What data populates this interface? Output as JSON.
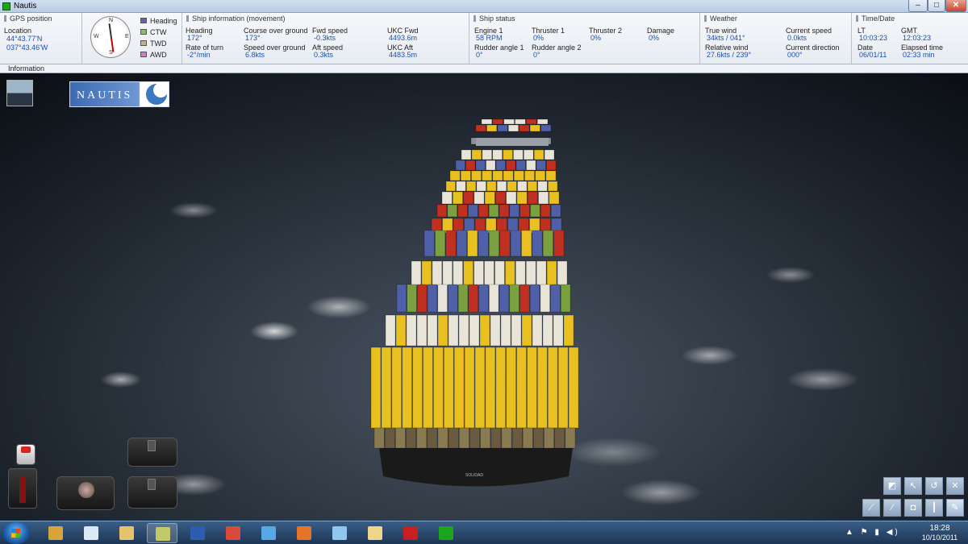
{
  "window": {
    "title": "Nautis",
    "minimize": "–",
    "maximize": "□",
    "close": "✕"
  },
  "gps": {
    "heading": "GPS position",
    "location_label": "Location",
    "latitude": "44°43.77'N",
    "longitude": "037°43.46'W"
  },
  "compass": {
    "directions": {
      "n": "N",
      "s": "S",
      "e": "E",
      "w": "W"
    },
    "legend": [
      {
        "label": "Heading",
        "color": "#6a5fb0"
      },
      {
        "label": "CTW",
        "color": "#8fbf5a"
      },
      {
        "label": "TWD",
        "color": "#c4b08a"
      },
      {
        "label": "AWD",
        "color": "#d07ad0"
      }
    ]
  },
  "ship_info": {
    "heading": "Ship information (movement)",
    "fields": {
      "heading": {
        "label": "Heading",
        "value": "172°"
      },
      "rate_of_turn": {
        "label": "Rate of turn",
        "value": "-2°/min"
      },
      "course_over_ground": {
        "label": "Course over ground",
        "value": "173°"
      },
      "speed_over_ground": {
        "label": "Speed over ground",
        "value": "6.8kts"
      },
      "fwd_speed": {
        "label": "Fwd speed",
        "value": "-0.3kts"
      },
      "aft_speed": {
        "label": "Aft speed",
        "value": "0.3kts"
      },
      "ukc_fwd": {
        "label": "UKC Fwd",
        "value": "4493.6m"
      },
      "ukc_aft": {
        "label": "UKC Aft",
        "value": "4483.5m"
      }
    }
  },
  "ship_status": {
    "heading": "Ship status",
    "fields": {
      "engine1": {
        "label": "Engine 1",
        "value": "58 RPM"
      },
      "rudder1": {
        "label": "Rudder angle 1",
        "value": "0°"
      },
      "thruster1": {
        "label": "Thruster 1",
        "value": "0%"
      },
      "rudder2": {
        "label": "Rudder angle 2",
        "value": "0°"
      },
      "thruster2": {
        "label": "Thruster 2",
        "value": "0%"
      },
      "damage": {
        "label": "Damage",
        "value": "0%"
      }
    }
  },
  "weather": {
    "heading": "Weather",
    "fields": {
      "true_wind": {
        "label": "True wind",
        "value": "34kts / 041°"
      },
      "relative_wind": {
        "label": "Relative wind",
        "value": "27.6kts / 239°"
      },
      "current_speed": {
        "label": "Current speed",
        "value": "0.0kts"
      },
      "current_direction": {
        "label": "Current direction",
        "value": "000°"
      }
    }
  },
  "time": {
    "heading": "Time/Date",
    "fields": {
      "lt": {
        "label": "LT",
        "value": "10:03:23"
      },
      "gmt": {
        "label": "GMT",
        "value": "12:03:23"
      },
      "date": {
        "label": "Date",
        "value": "06/01/11"
      },
      "elapsed": {
        "label": "Elapsed time",
        "value": "02:33 min"
      }
    }
  },
  "info_bar": {
    "label": "Information"
  },
  "overlay": {
    "logo_text": "NAUTIS",
    "ship_name": "SOLIDAD"
  },
  "taskbar": {
    "clock_time": "18:28",
    "clock_date": "10/10/2011",
    "tray_icons": "▲ ⚑ ▮ ◀)",
    "apps": [
      {
        "name": "media-icon",
        "color": "#d8a33a"
      },
      {
        "name": "document-icon",
        "color": "#dbe8f6"
      },
      {
        "name": "explorer-icon",
        "color": "#e5c26b"
      },
      {
        "name": "paint-icon",
        "color": "#c2c96a",
        "active": true
      },
      {
        "name": "word-icon",
        "color": "#2d5db1"
      },
      {
        "name": "pdf-creator-icon",
        "color": "#d84a3a"
      },
      {
        "name": "messenger-icon",
        "color": "#56a8e6"
      },
      {
        "name": "firefox-icon",
        "color": "#e5742a"
      },
      {
        "name": "notepad-icon",
        "color": "#8ec7ef"
      },
      {
        "name": "cloud-icon",
        "color": "#f0d48a"
      },
      {
        "name": "acrobat-icon",
        "color": "#c8201c"
      },
      {
        "name": "nautis-icon",
        "color": "#1aa51a"
      }
    ]
  },
  "colors": {
    "value_blue": "#1c4fae",
    "container_yellow": "#e8c020",
    "container_red": "#c03020",
    "container_blue": "#5060a8",
    "container_white": "#e8e4d8",
    "hull": "#1a1a1a"
  }
}
